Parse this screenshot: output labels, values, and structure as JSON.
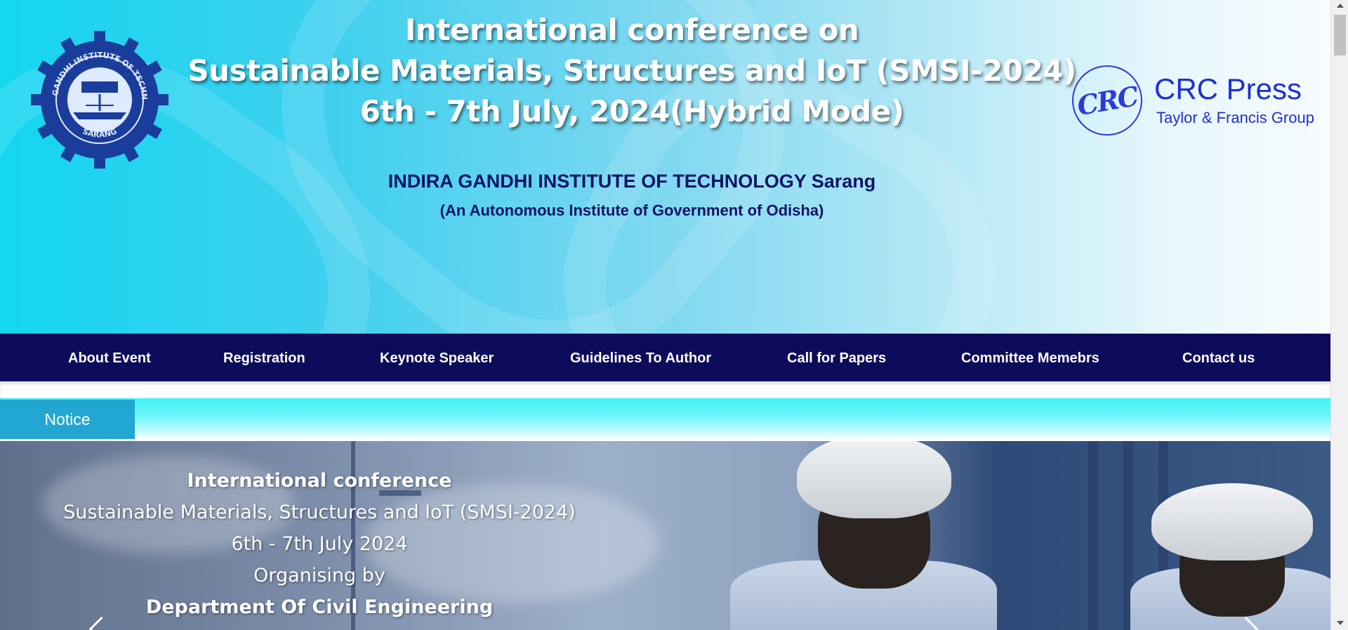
{
  "header": {
    "title_lines": [
      "International conference on",
      "Sustainable Materials, Structures and IoT (SMSI-2024)",
      "6th - 7th July, 2024(Hybrid Mode)"
    ],
    "institute_name": "INDIRA GANDHI INSTITUTE OF TECHNOLOGY Sarang",
    "institute_subtitle": "(An Autonomous Institute of Government of Odisha)",
    "logo_left": {
      "icon": "igit-sarang-gear-seal-logo",
      "ring_text": "INDIRA GANDHI INSTITUTE OF TECHNOLOGY",
      "bottom_text": "SARANG",
      "color": "#1a3d9c"
    },
    "logo_right": {
      "icon": "crc-press-logo",
      "mark": "CRC",
      "name": "CRC Press",
      "group": "Taylor & Francis Group",
      "color": "#1e2fd6"
    }
  },
  "nav": {
    "items": [
      "About Event",
      "Registration",
      "Keynote Speaker",
      "Guidelines To Author",
      "Call for Papers",
      "Committee Memebrs",
      "Contact us"
    ],
    "background": "#0c0c5a"
  },
  "notice": {
    "label": "Notice",
    "label_color": "#22a6d2"
  },
  "hero": {
    "lines": [
      "International conference",
      "Sustainable Materials, Structures and IoT (SMSI-2024)",
      "6th - 7th July 2024",
      "Organising by",
      "Department Of Civil Engineering"
    ],
    "prev_icon": "chevron-left-icon",
    "next_icon": "chevron-right-icon"
  }
}
